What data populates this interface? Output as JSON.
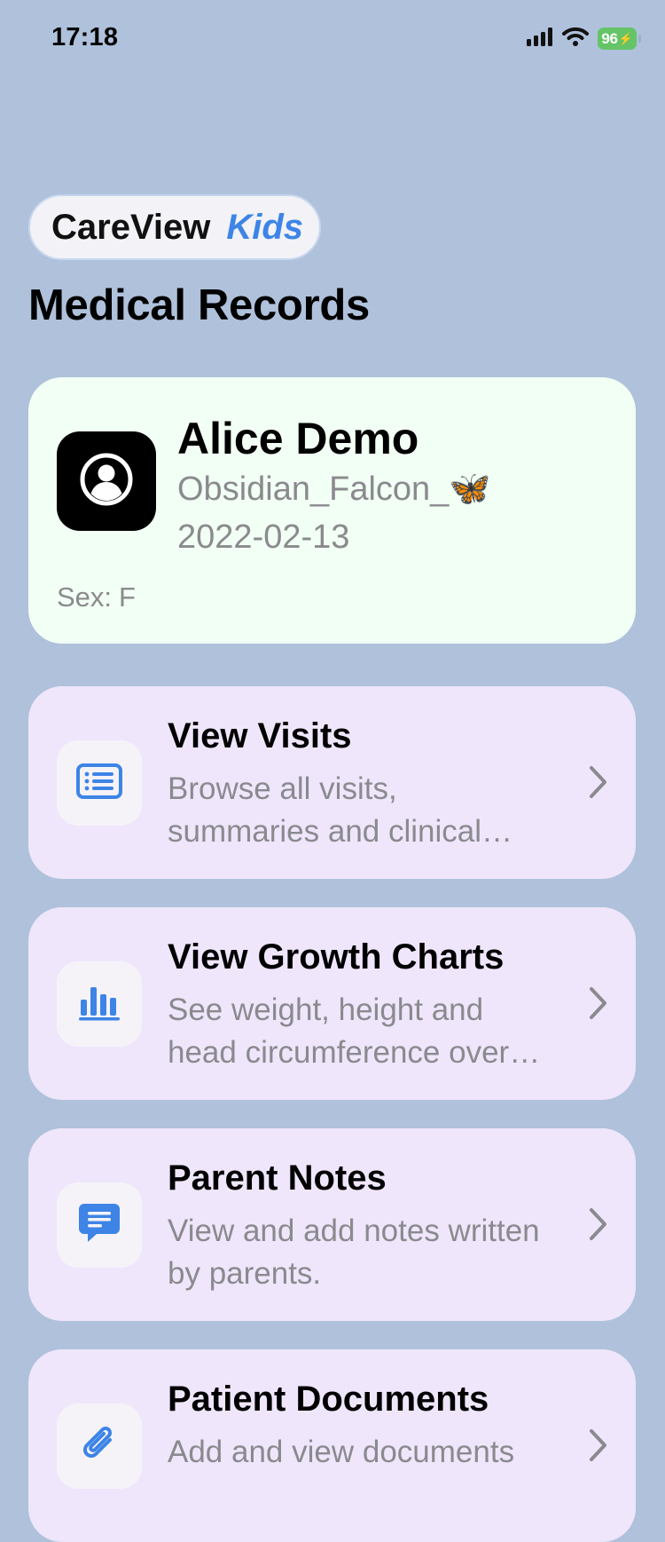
{
  "status_bar": {
    "time": "17:18",
    "battery": "96",
    "icons": [
      "signal-icon",
      "wifi-icon",
      "battery-charging-icon"
    ]
  },
  "brand": {
    "name": "CareView",
    "accent": "Kids",
    "accent_color": "#3D84E6"
  },
  "page": {
    "title": "Medical Records"
  },
  "patient": {
    "name": "Alice Demo",
    "handle": "Obsidian_Falcon_🦋",
    "dob": "2022-02-13",
    "sex_label": "Sex:",
    "sex_value": "F",
    "avatar_icon": "person-circle-icon"
  },
  "menu": [
    {
      "title": "View Visits",
      "description": "Browse all visits, summaries and clinical notes",
      "icon": "list-icon"
    },
    {
      "title": "View Growth Charts",
      "description": "See weight, height and head circumference over time",
      "icon": "bar-chart-icon"
    },
    {
      "title": "Parent Notes",
      "description": "View and add notes written by parents.",
      "icon": "message-icon"
    },
    {
      "title": "Patient Documents",
      "description": "Add and view documents",
      "icon": "paperclip-icon"
    }
  ],
  "colors": {
    "background": "#AFC1DB",
    "patient_card": "#F2FFF4",
    "menu_card": "#EFE6FC",
    "icon_blue": "#3D84E6",
    "battery_green": "#65C466"
  }
}
